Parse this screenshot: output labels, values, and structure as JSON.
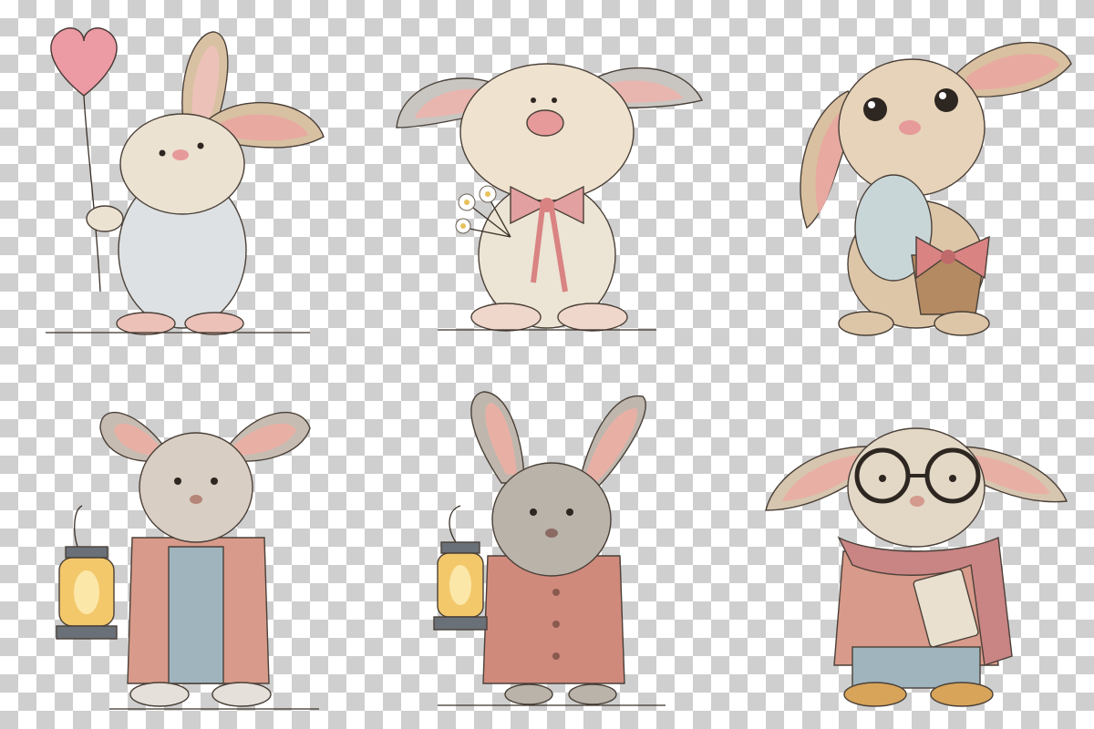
{
  "illustrations": [
    {
      "subject": "bunny-with-heart-balloon"
    },
    {
      "subject": "bunny-with-daisies-and-bow"
    },
    {
      "subject": "bunny-holding-easter-egg-basket"
    },
    {
      "subject": "bunny-with-lantern-in-jacket"
    },
    {
      "subject": "bunny-with-lantern-in-coat"
    },
    {
      "subject": "bunny-with-glasses-scarf-book"
    }
  ],
  "colors": {
    "fur_light": "#efe3cf",
    "fur_tan": "#d9c0a0",
    "fur_grey": "#b9b3aa",
    "inner_ear": "#e8a9a0",
    "nose": "#e69a9a",
    "pink_accent": "#d98383",
    "coat": "#d89a8a",
    "denim": "#9fb4bd",
    "lantern_glow": "#f3c86b",
    "checker": "#cfcfcf"
  }
}
